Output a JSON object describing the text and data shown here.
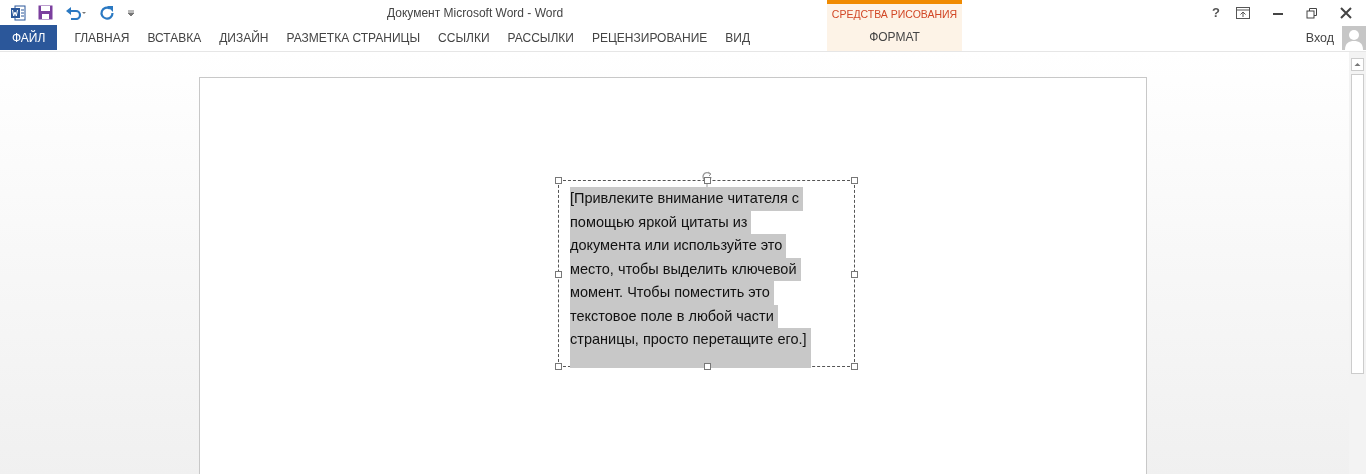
{
  "window": {
    "title": "Документ Microsoft Word - Word"
  },
  "tabs": [
    {
      "label": "ФАЙЛ",
      "selected": true
    },
    {
      "label": "ГЛАВНАЯ",
      "selected": false
    },
    {
      "label": "ВСТАВКА",
      "selected": false
    },
    {
      "label": "ДИЗАЙН",
      "selected": false
    },
    {
      "label": "РАЗМЕТКА СТРАНИЦЫ",
      "selected": false
    },
    {
      "label": "ССЫЛКИ",
      "selected": false
    },
    {
      "label": "РАССЫЛКИ",
      "selected": false
    },
    {
      "label": "РЕЦЕНЗИРОВАНИЕ",
      "selected": false
    },
    {
      "label": "ВИД",
      "selected": false
    }
  ],
  "context_group": {
    "label": "СРЕДСТВА РИСОВАНИЯ",
    "tabs": [
      {
        "label": "ФОРМАТ",
        "selected": false
      }
    ]
  },
  "window_controls": [
    "?"
  ],
  "sign_in": "Вход",
  "text_box": {
    "lines": [
      "[Привлеките внимание читателя с",
      "помощью яркой цитаты из",
      "документа или используйте это",
      "место, чтобы выделить ключевой",
      "момент. Чтобы поместить это",
      "текстовое поле в любой части",
      "страницы, просто перетащите его.]"
    ]
  }
}
